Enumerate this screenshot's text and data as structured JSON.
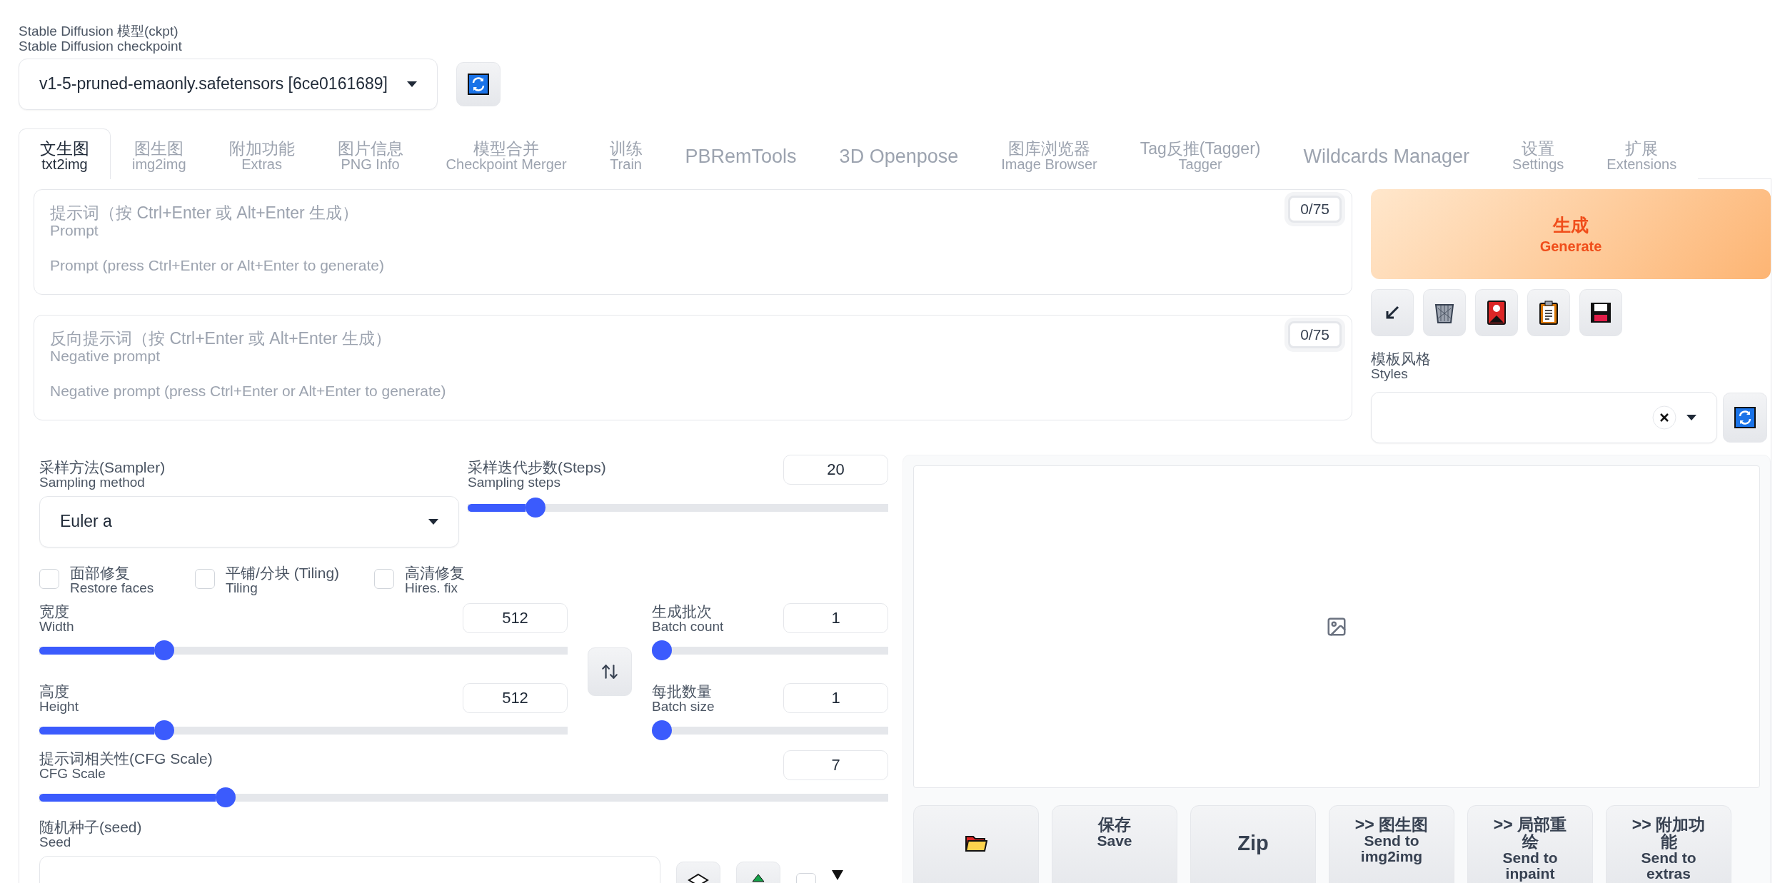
{
  "checkpoint": {
    "title": "Stable Diffusion 模型(ckpt)",
    "subtitle": "Stable Diffusion checkpoint",
    "value": "v1-5-pruned-emaonly.safetensors [6ce0161689]"
  },
  "tabs": [
    {
      "title": "文生图",
      "subtitle": "txt2img",
      "selected": true
    },
    {
      "title": "图生图",
      "subtitle": "img2img",
      "selected": false
    },
    {
      "title": "附加功能",
      "subtitle": "Extras",
      "selected": false
    },
    {
      "title": "图片信息",
      "subtitle": "PNG Info",
      "selected": false
    },
    {
      "title": "模型合并",
      "subtitle": "Checkpoint Merger",
      "selected": false
    },
    {
      "title": "训练",
      "subtitle": "Train",
      "selected": false
    },
    {
      "title": "PBRemTools",
      "selected": false
    },
    {
      "title": "3D Openpose",
      "selected": false
    },
    {
      "title": "图库浏览器",
      "subtitle": "Image Browser",
      "selected": false
    },
    {
      "title": "Tag反推(Tagger)",
      "subtitle": "Tagger",
      "selected": false
    },
    {
      "title": "Wildcards Manager",
      "selected": false
    },
    {
      "title": "设置",
      "subtitle": "Settings",
      "selected": false
    },
    {
      "title": "扩展",
      "subtitle": "Extensions",
      "selected": false
    }
  ],
  "prompts": [
    {
      "title": "提示词（按 Ctrl+Enter 或 Alt+Enter 生成）",
      "subtitle": "Prompt",
      "placeholder": "Prompt (press Ctrl+Enter or Alt+Enter to generate)",
      "token_count": "0/75"
    },
    {
      "title": "反向提示词（按 Ctrl+Enter 或 Alt+Enter 生成）",
      "subtitle": "Negative prompt",
      "placeholder": "Negative prompt (press Ctrl+Enter or Alt+Enter to generate)",
      "token_count": "0/75"
    }
  ],
  "generate": {
    "title": "生成",
    "subtitle": "Generate"
  },
  "styles": {
    "title": "模板风格",
    "subtitle": "Styles"
  },
  "sampler": {
    "title": "采样方法(Sampler)",
    "subtitle": "Sampling method",
    "value": "Euler a"
  },
  "steps": {
    "title": "采样迭代步数(Steps)",
    "subtitle": "Sampling steps",
    "value": "20",
    "level": 0.145
  },
  "checkboxes": [
    {
      "title": "面部修复",
      "subtitle": "Restore faces",
      "checked": false
    },
    {
      "title": "平铺/分块 (Tiling)",
      "subtitle": "Tiling",
      "checked": false
    },
    {
      "title": "高清修复",
      "subtitle": "Hires. fix",
      "checked": false
    }
  ],
  "dimension_sliders": [
    {
      "title": "宽度",
      "subtitle": "Width",
      "value": "512",
      "level": 0.226
    },
    {
      "title": "高度",
      "subtitle": "Height",
      "value": "512",
      "level": 0.226
    }
  ],
  "batch_sliders": [
    {
      "title": "生成批次",
      "subtitle": "Batch count",
      "value": "1",
      "level": 0
    },
    {
      "title": "每批数量",
      "subtitle": "Batch size",
      "value": "1",
      "level": 0
    }
  ],
  "cfg": {
    "title": "提示词相关性(CFG Scale)",
    "subtitle": "CFG Scale",
    "value": "7",
    "level": 0.213
  },
  "seed": {
    "title": "随机种子(seed)",
    "subtitle": "Seed",
    "extra_checked": false
  },
  "gallery_buttons": [
    {
      "kind": "folder"
    },
    {
      "kind": "text",
      "title": "保存",
      "subtitle": "Save"
    },
    {
      "kind": "text",
      "title": "Zip"
    },
    {
      "kind": "text",
      "title": ">> 图生图",
      "subtitle": "Send to img2img"
    },
    {
      "kind": "text",
      "title": ">> 局部重绘",
      "subtitle": "Send to inpaint"
    },
    {
      "kind": "text",
      "title": ">> 附加功能",
      "subtitle": "Send to extras"
    }
  ]
}
